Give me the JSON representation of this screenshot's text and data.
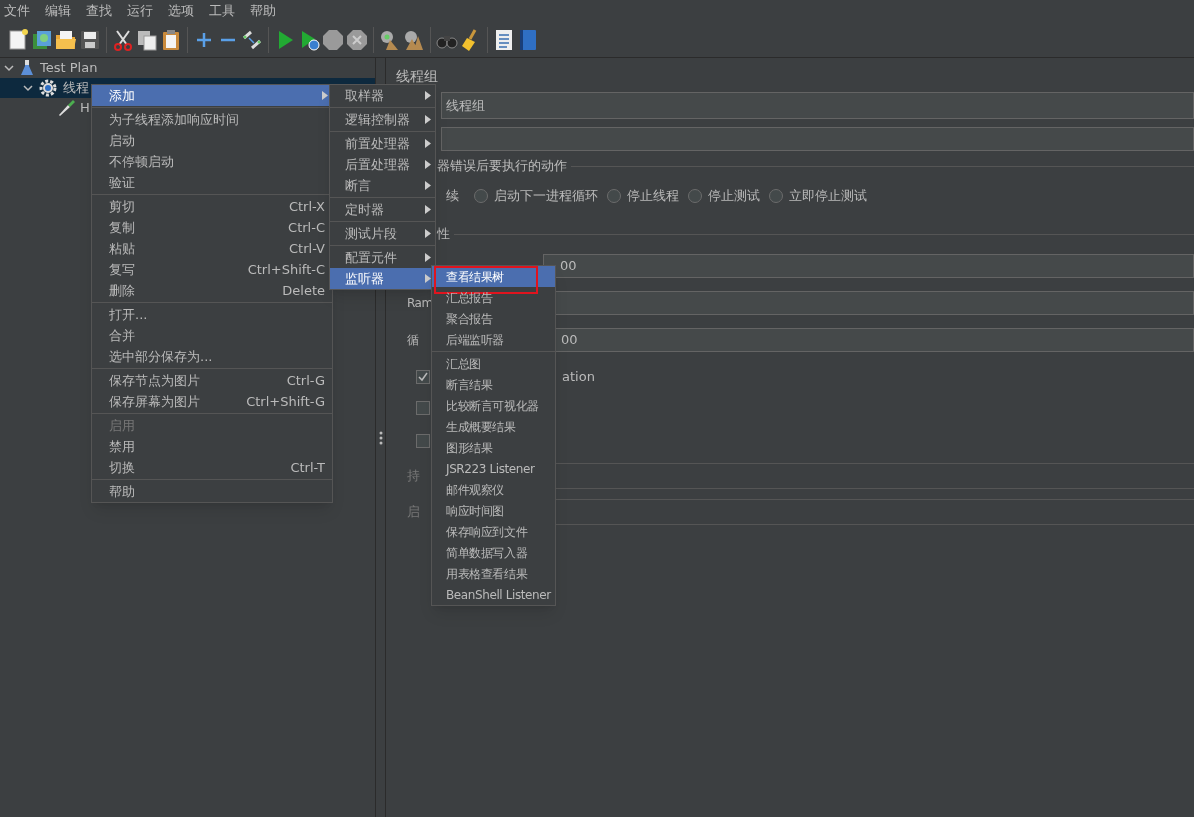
{
  "menu_bar": [
    {
      "label": "文件"
    },
    {
      "label": "编辑"
    },
    {
      "label": "查找"
    },
    {
      "label": "运行"
    },
    {
      "label": "选项"
    },
    {
      "label": "工具"
    },
    {
      "label": "帮助"
    }
  ],
  "tree": [
    {
      "label": "Test Plan",
      "kind": "plan",
      "expanded": true,
      "selected": false,
      "children": [
        {
          "label": "线程",
          "kind": "thread_group",
          "expanded": true,
          "selected": true,
          "children": [
            {
              "label": "H",
              "kind": "sampler",
              "selected": false
            }
          ]
        }
      ]
    }
  ],
  "context_menu": {
    "groups": [
      [
        {
          "label": "添加",
          "has_submenu": true,
          "selected": true,
          "disabled": false
        }
      ],
      [
        {
          "label": "为子线程添加响应时间",
          "has_submenu": false,
          "selected": false,
          "disabled": false
        },
        {
          "label": "启动",
          "has_submenu": false,
          "selected": false,
          "disabled": false
        },
        {
          "label": "不停顿启动",
          "has_submenu": false,
          "selected": false,
          "disabled": false
        },
        {
          "label": "验证",
          "has_submenu": false,
          "selected": false,
          "disabled": false
        }
      ],
      [
        {
          "label": "剪切",
          "shortcut": "Ctrl-X",
          "has_submenu": false,
          "selected": false,
          "disabled": false
        },
        {
          "label": "复制",
          "shortcut": "Ctrl-C",
          "has_submenu": false,
          "selected": false,
          "disabled": false
        },
        {
          "label": "粘贴",
          "shortcut": "Ctrl-V",
          "has_submenu": false,
          "selected": false,
          "disabled": false
        },
        {
          "label": "复写",
          "shortcut": "Ctrl+Shift-C",
          "has_submenu": false,
          "selected": false,
          "disabled": false
        },
        {
          "label": "删除",
          "shortcut": "Delete",
          "has_submenu": false,
          "selected": false,
          "disabled": false
        }
      ],
      [
        {
          "label": "打开...",
          "has_submenu": false,
          "selected": false,
          "disabled": false
        },
        {
          "label": "合并",
          "has_submenu": false,
          "selected": false,
          "disabled": false
        },
        {
          "label": "选中部分保存为...",
          "has_submenu": false,
          "selected": false,
          "disabled": false
        }
      ],
      [
        {
          "label": "保存节点为图片",
          "shortcut": "Ctrl-G",
          "has_submenu": false,
          "selected": false,
          "disabled": false
        },
        {
          "label": "保存屏幕为图片",
          "shortcut": "Ctrl+Shift-G",
          "has_submenu": false,
          "selected": false,
          "disabled": false
        }
      ],
      [
        {
          "label": "启用",
          "has_submenu": false,
          "selected": false,
          "disabled": true
        },
        {
          "label": "禁用",
          "has_submenu": false,
          "selected": false,
          "disabled": false
        },
        {
          "label": "切换",
          "shortcut": "Ctrl-T",
          "has_submenu": false,
          "selected": false,
          "disabled": false
        }
      ],
      [
        {
          "label": "帮助",
          "has_submenu": false,
          "selected": false,
          "disabled": false
        }
      ]
    ]
  },
  "add_menu": {
    "groups": [
      [
        {
          "label": "取样器",
          "has_submenu": true,
          "selected": false
        }
      ],
      [
        {
          "label": "逻辑控制器",
          "has_submenu": true,
          "selected": false
        }
      ],
      [
        {
          "label": "前置处理器",
          "has_submenu": true,
          "selected": false
        },
        {
          "label": "后置处理器",
          "has_submenu": true,
          "selected": false
        },
        {
          "label": "断言",
          "has_submenu": true,
          "selected": false
        }
      ],
      [
        {
          "label": "定时器",
          "has_submenu": true,
          "selected": false
        }
      ],
      [
        {
          "label": "测试片段",
          "has_submenu": true,
          "selected": false
        }
      ],
      [
        {
          "label": "配置元件",
          "has_submenu": true,
          "selected": false
        },
        {
          "label": "监听器",
          "has_submenu": true,
          "selected": true
        }
      ]
    ]
  },
  "listener_menu": {
    "groups": [
      [
        {
          "label": "查看结果树",
          "selected": true,
          "highlighted": true
        },
        {
          "label": "汇总报告",
          "selected": false,
          "highlighted": false
        },
        {
          "label": "聚合报告",
          "selected": false,
          "highlighted": false
        },
        {
          "label": "后端监听器",
          "selected": false,
          "highlighted": false
        }
      ],
      [
        {
          "label": "汇总图",
          "selected": false,
          "highlighted": false
        },
        {
          "label": "断言结果",
          "selected": false,
          "highlighted": false
        },
        {
          "label": "比较断言可视化器",
          "selected": false,
          "highlighted": false
        },
        {
          "label": "生成概要结果",
          "selected": false,
          "highlighted": false
        },
        {
          "label": "图形结果",
          "selected": false,
          "highlighted": false
        },
        {
          "label": "JSR223 Listener",
          "selected": false,
          "highlighted": false
        },
        {
          "label": "邮件观察仪",
          "selected": false,
          "highlighted": false
        },
        {
          "label": "响应时间图",
          "selected": false,
          "highlighted": false
        },
        {
          "label": "保存响应到文件",
          "selected": false,
          "highlighted": false
        },
        {
          "label": "简单数据写入器",
          "selected": false,
          "highlighted": false
        },
        {
          "label": "用表格查看结果",
          "selected": false,
          "highlighted": false
        },
        {
          "label": "BeanShell Listener",
          "selected": false,
          "highlighted": false
        }
      ]
    ]
  },
  "editor": {
    "title": "线程组",
    "name_field": {
      "value": "线程组"
    },
    "error_action": {
      "legend": "器错误后要执行的动作",
      "continue_label": "续",
      "options": [
        {
          "label": "启动下一进程循环",
          "selected": false
        },
        {
          "label": "停止线程",
          "selected": false
        },
        {
          "label": "停止测试",
          "selected": false
        },
        {
          "label": "立即停止测试",
          "selected": false
        }
      ]
    },
    "properties": {
      "legend": "性",
      "rows": [
        {
          "kind": "field",
          "value": "00"
        },
        {
          "kind": "labeled_field",
          "label": "Ram"
        },
        {
          "kind": "labeled_field",
          "label": "循",
          "value": "00"
        },
        {
          "kind": "checkbox",
          "checked": true,
          "label": "ation"
        },
        {
          "kind": "checkbox",
          "checked": false
        },
        {
          "kind": "checkbox",
          "checked": false
        },
        {
          "kind": "disabled_field",
          "label": "持"
        },
        {
          "kind": "disabled_field",
          "label": "启"
        }
      ]
    }
  }
}
